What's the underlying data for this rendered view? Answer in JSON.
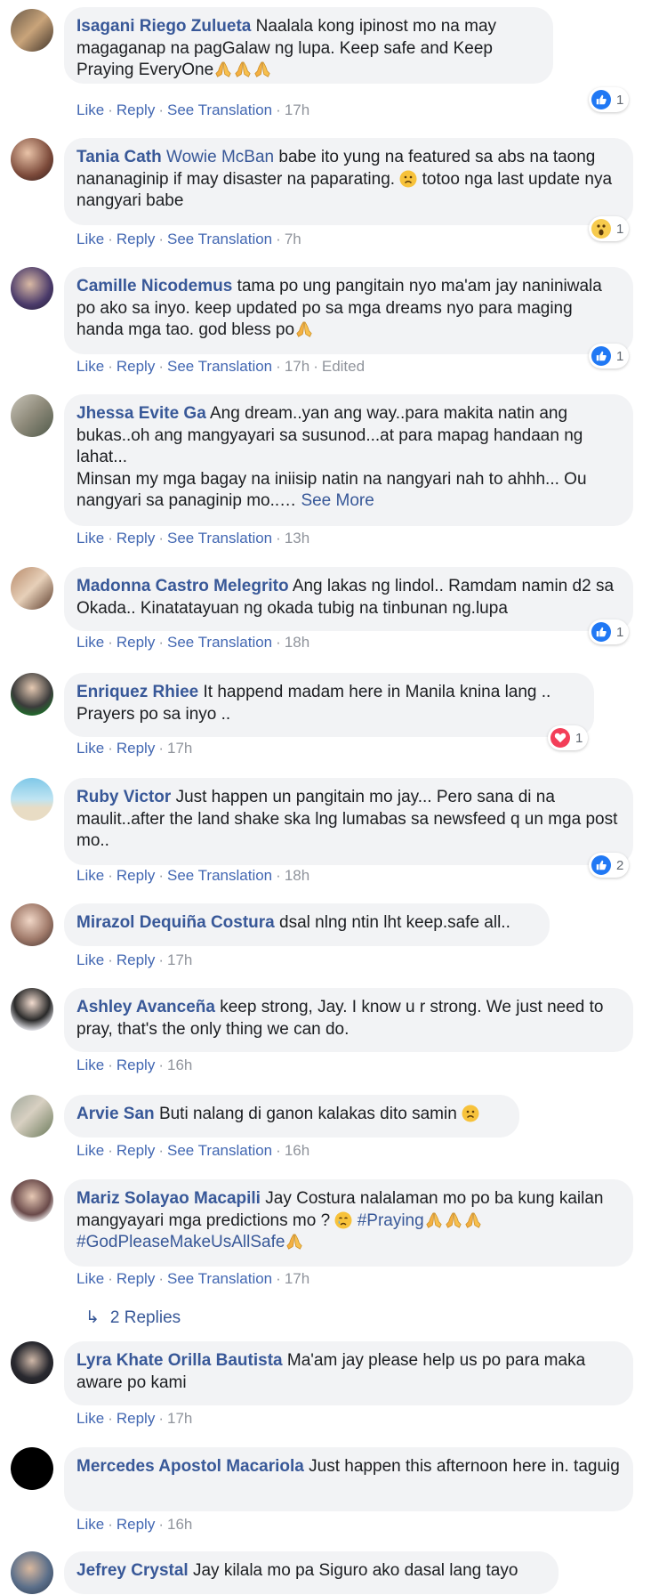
{
  "actions": {
    "like": "Like",
    "reply": "Reply",
    "see_translation": "See Translation",
    "edited": "Edited",
    "see_more": "See More"
  },
  "colors": {
    "link": "#385898",
    "bubble_bg": "#f2f3f5",
    "meta": "#90949c",
    "like_blue": "#2078f4",
    "love_red": "#f33e58",
    "wow_yellow": "#f7cb4d"
  },
  "comments": [
    {
      "author": "Isagani Riego Zulueta",
      "text": "Naalala kong ipinost mo na may magaganap na pagGalaw ng lupa. Keep safe and Keep Praying EveryOne",
      "time": "17h",
      "reaction": {
        "type": "like-icon",
        "count": "1"
      }
    },
    {
      "author": "Tania Cath",
      "mention": "Wowie McBan",
      "text": "babe ito yung na featured sa abs na taong nananaginip if may disaster na paparating.",
      "text2": "totoo nga last update nya nangyari babe",
      "time": "7h",
      "reaction": {
        "type": "wow-icon",
        "count": "1"
      }
    },
    {
      "author": "Camille Nicodemus",
      "text": "tama po ung pangitain nyo ma'am jay naniniwala po ako sa inyo. keep updated po sa mga dreams nyo para maging handa mga tao. god bless po",
      "time": "17h",
      "reaction": {
        "type": "like-icon",
        "count": "1"
      }
    },
    {
      "author": "Jhessa Evite Ga",
      "text": "Ang dream..yan ang way..para makita natin ang bukas..oh ang mangyayari sa susunod...at para mapag handaan ng lahat...",
      "text2": "Minsan my mga bagay na iniisip natin na nangyari nah to ahhh... Ou nangyari sa panaginip mo..…",
      "time": "13h"
    },
    {
      "author": "Madonna Castro Melegrito",
      "text": "Ang lakas ng lindol.. Ramdam namin d2 sa Okada.. Kinatatayuan ng okada tubig na tinbunan ng.lupa",
      "time": "18h",
      "reaction": {
        "type": "like-icon",
        "count": "1"
      }
    },
    {
      "author": "Enriquez Rhiee",
      "text": "It happend madam here in Manila knina lang .. Prayers po sa inyo ..",
      "time": "17h",
      "reaction": {
        "type": "love-icon",
        "count": "1"
      }
    },
    {
      "author": "Ruby Victor",
      "text": "Just happen un pangitain mo jay... Pero sana di na maulit..after the land shake ska lng lumabas sa newsfeed q un mga post mo..",
      "time": "18h",
      "reaction": {
        "type": "like-icon",
        "count": "2"
      }
    },
    {
      "author": "Mirazol Dequiña Costura",
      "text": "dsal nlng ntin lht keep.safe all..",
      "time": "17h"
    },
    {
      "author": "Ashley Avanceña",
      "text": "keep strong, Jay. I know u r strong. We just need to pray, that's the only thing we can do.",
      "time": "16h"
    },
    {
      "author": "Arvie San",
      "text": "Buti nalang di ganon kalakas dito samin",
      "time": "16h"
    },
    {
      "author": "Mariz Solayao Macapili",
      "text": "Jay Costura nalalaman mo po ba kung kailan mangyayari mga predictions mo ?",
      "hashtag1": "#Praying",
      "hashtag2": "#GodPleaseMakeUsAllSafe",
      "time": "17h",
      "replies": "2 Replies"
    },
    {
      "author": "Lyra Khate Orilla Bautista",
      "text": "Ma'am jay please help us po para maka aware po kami",
      "time": "17h"
    },
    {
      "author": "Mercedes Apostol Macariola",
      "text": "Just happen this afternoon here in. taguig",
      "time": "16h"
    },
    {
      "author": "Jefrey Crystal",
      "text": "Jay kilala mo pa Siguro ako dasal lang tayo"
    }
  ]
}
